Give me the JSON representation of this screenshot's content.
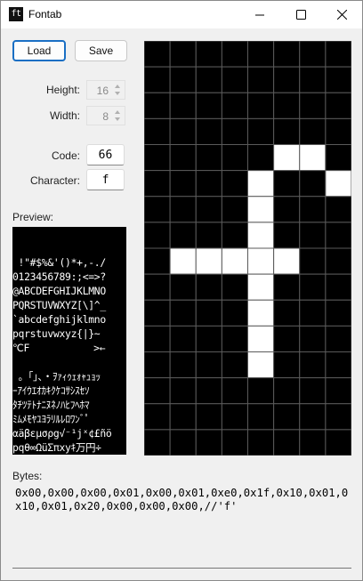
{
  "window": {
    "title": "Fontab",
    "app_icon_text": "ft"
  },
  "toolbar": {
    "load_label": "Load",
    "save_label": "Save"
  },
  "settings": {
    "height_label": "Height:",
    "height_value": "16",
    "width_label": "Width:",
    "width_value": "8",
    "code_label": "Code:",
    "code_value": "66",
    "character_label": "Character:",
    "character_value": "f"
  },
  "preview": {
    "label": "Preview:",
    "lines": [
      "",
      "",
      " !\"#$%&'()*+,-./",
      "0123456789:;<=>?",
      "@ABCDEFGHIJKLMNO",
      "PQRSTUVWXYZ[\\]^_",
      "`abcdefghijklmno",
      "pqrstuvwxyz{|}~",
      "℃F           >←",
      "",
      " 。「」、・ｦｧｨｩｪｫｬｭｮｯ",
      "ｰｱｲｳｴｵｶｷｸｹｺｻｼｽｾｿ",
      "ﾀﾁﾂﾃﾄﾅﾆﾇﾈﾉﾊﾋﾌﾍﾎﾏ",
      "ﾐﾑﾒﾓﾔﾕﾖﾗﾘﾙﾚﾛﾜﾝﾞﾟ",
      "αäβεμσρg√⁻¹jˣ¢£ñö",
      "pqθ∞ΩüΣπxyｷ万円÷ "
    ]
  },
  "glyph": {
    "columns": 8,
    "rows": 16,
    "on_color": "#ffffff",
    "off_color": "#000000",
    "grid_color": "#5a5a5a",
    "bitmap": [
      "00000000",
      "00000000",
      "00000000",
      "00000000",
      "00000110",
      "00001001",
      "00001000",
      "00001000",
      "01111100",
      "00001000",
      "00001000",
      "00001000",
      "00001000",
      "00000000",
      "00000000",
      "00000000"
    ]
  },
  "bytes": {
    "label": "Bytes:",
    "text": "0x00,0x00,0x00,0x01,0x00,0x01,0xe0,0x1f,0x10,0x01,0x10,0x01,0x20,0x00,0x00,0x00,//'f'"
  }
}
